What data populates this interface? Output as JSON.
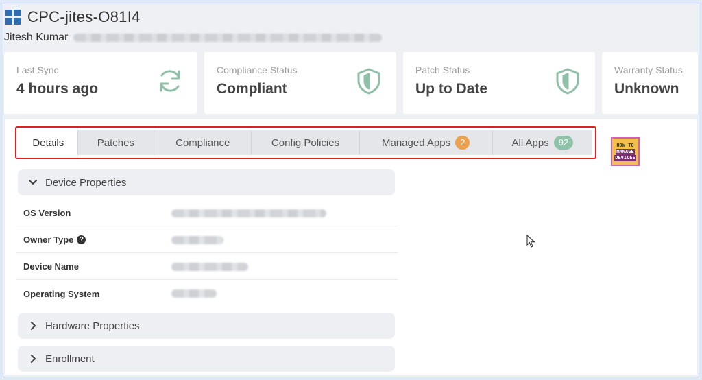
{
  "header": {
    "title": "CPC-jites-O81I4",
    "user_name": "Jitesh Kumar"
  },
  "cards": [
    {
      "label": "Last Sync",
      "value": "4 hours ago",
      "icon": "sync-icon"
    },
    {
      "label": "Compliance Status",
      "value": "Compliant",
      "icon": "shield-icon"
    },
    {
      "label": "Patch Status",
      "value": "Up to Date",
      "icon": "shield-icon"
    },
    {
      "label": "Warranty Status",
      "value": "Unknown",
      "icon": ""
    }
  ],
  "tabs": [
    {
      "label": "Details",
      "active": true
    },
    {
      "label": "Patches"
    },
    {
      "label": "Compliance"
    },
    {
      "label": "Config Policies"
    },
    {
      "label": "Managed Apps",
      "badge": "2",
      "badge_color": "#eba14e"
    },
    {
      "label": "All Apps",
      "badge": "92",
      "badge_color": "#8fc2a8"
    }
  ],
  "sections": {
    "device_properties": "Device Properties",
    "hardware_properties": "Hardware Properties",
    "enrollment": "Enrollment"
  },
  "properties": [
    {
      "label": "OS Version"
    },
    {
      "label": "Owner Type",
      "help": true
    },
    {
      "label": "Device Name"
    },
    {
      "label": "Operating System"
    }
  ],
  "logo": {
    "line1": "HOW TO",
    "line2": "MANAGE",
    "line3": "DEVICES"
  },
  "colors": {
    "accent_green": "#8fbfa6",
    "tab_highlight_border": "#e02020",
    "windows_blue": "#2f6db3"
  }
}
